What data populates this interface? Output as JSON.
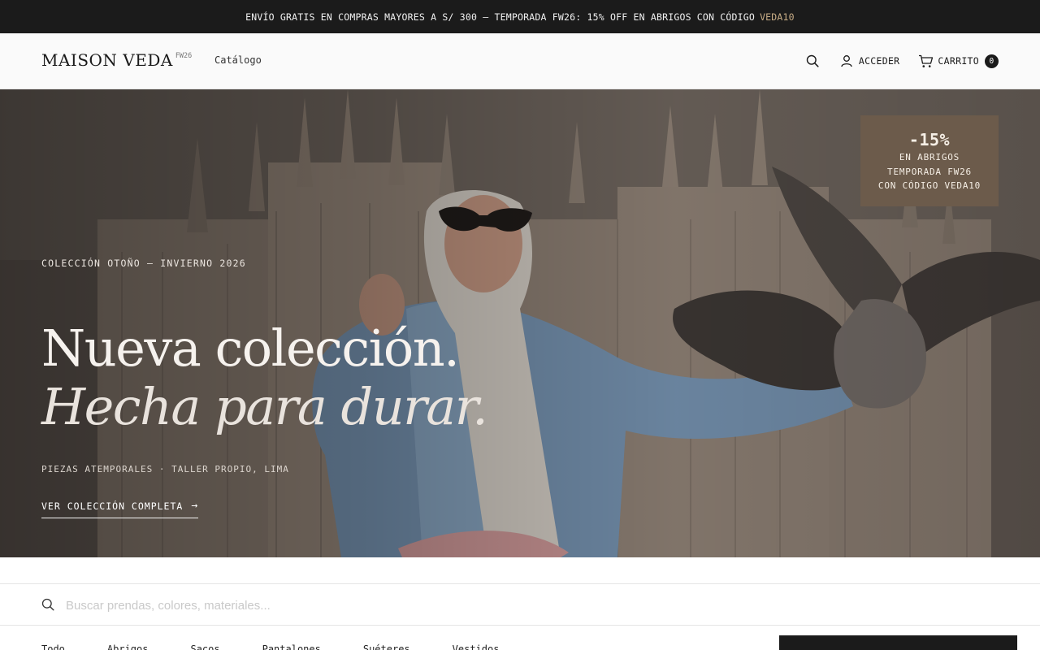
{
  "promo": {
    "text": "ENVÍO GRATIS EN COMPRAS MAYORES A S/ 300 — TEMPORADA FW26: 15% OFF EN ABRIGOS CON CÓDIGO",
    "code": "VEDA10"
  },
  "header": {
    "logo": "MAISON VEDA",
    "logo_sup": "FW26",
    "nav_catalog": "Catálogo",
    "login_label": "ACCEDER",
    "cart_label": "CARRITO",
    "cart_count": "0"
  },
  "hero": {
    "eyebrow": "COLECCIÓN OTOÑO — INVIERNO 2026",
    "headline_line1": "Nueva colección.",
    "headline_line2": "Hecha para durar.",
    "subtitle": "PIEZAS ATEMPORALES · TALLER PROPIO, LIMA",
    "cta_label": "VER COLECCIÓN COMPLETA",
    "cta_arrow": "→"
  },
  "discount": {
    "percent": "-15%",
    "line1": "EN ABRIGOS",
    "line2": "TEMPORADA FW26",
    "line3": "CON CÓDIGO VEDA10"
  },
  "search": {
    "placeholder": "Buscar prendas, colores, materiales..."
  },
  "filters": [
    "Todo",
    "Abrigos",
    "Sacos",
    "Pantalones",
    "Suéteres",
    "Vestidos"
  ],
  "colors": {
    "promo_bg": "#1b1b1b",
    "promo_code": "#c8ad86",
    "discount_bg": "#6c5b4b",
    "cart_badge": "#1a1a1a"
  },
  "icons": [
    "search-icon",
    "user-icon",
    "cart-icon",
    "arrow-right-icon"
  ]
}
